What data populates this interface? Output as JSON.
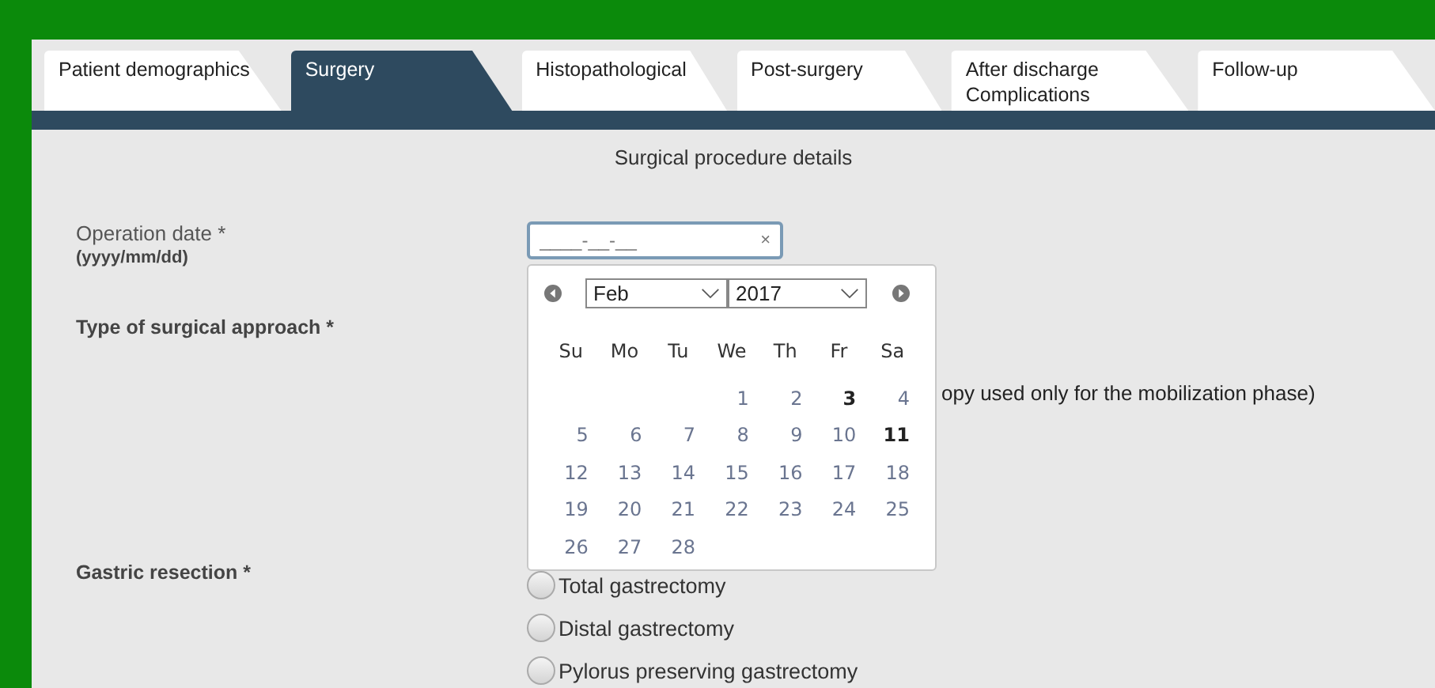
{
  "tabs": [
    {
      "label": "Patient demographics",
      "selected": false
    },
    {
      "label": "Surgery",
      "selected": true
    },
    {
      "label": "Histopathological",
      "selected": false
    },
    {
      "label": "Post-surgery",
      "selected": false
    },
    {
      "label": "After discharge\nComplications",
      "selected": false
    },
    {
      "label": "Follow-up",
      "selected": false
    }
  ],
  "section_title": "Surgical procedure details",
  "operation_date": {
    "label": "Operation date *",
    "hint": "(yyyy/mm/dd)",
    "placeholder": "____-__-__",
    "clear": "×"
  },
  "calendar": {
    "month": "Feb",
    "year": "2017",
    "weekdays": [
      "Su",
      "Mo",
      "Tu",
      "We",
      "Th",
      "Fr",
      "Sa"
    ],
    "weeks": [
      {
        "days": [
          {
            "label": "1",
            "bold": false
          },
          {
            "label": "2",
            "bold": false
          },
          {
            "label": "3",
            "bold": true
          },
          {
            "label": "4",
            "bold": false
          }
        ]
      },
      {
        "days": [
          {
            "label": "5",
            "bold": false
          },
          {
            "label": "6",
            "bold": false
          },
          {
            "label": "7",
            "bold": false
          },
          {
            "label": "8",
            "bold": false
          },
          {
            "label": "9",
            "bold": false
          },
          {
            "label": "10",
            "bold": false
          },
          {
            "label": "11",
            "bold": true
          }
        ]
      },
      {
        "days": [
          {
            "label": "12",
            "bold": false
          },
          {
            "label": "13",
            "bold": false
          },
          {
            "label": "14",
            "bold": false
          },
          {
            "label": "15",
            "bold": false
          },
          {
            "label": "16",
            "bold": false
          },
          {
            "label": "17",
            "bold": false
          },
          {
            "label": "18",
            "bold": false
          }
        ]
      },
      {
        "days": [
          {
            "label": "19",
            "bold": false
          },
          {
            "label": "20",
            "bold": false
          },
          {
            "label": "21",
            "bold": false
          },
          {
            "label": "22",
            "bold": false
          },
          {
            "label": "23",
            "bold": false
          },
          {
            "label": "24",
            "bold": false
          },
          {
            "label": "25",
            "bold": false
          }
        ]
      },
      {
        "days": [
          {
            "label": "26",
            "bold": false
          },
          {
            "label": "27",
            "bold": false
          },
          {
            "label": "28",
            "bold": false
          }
        ]
      }
    ]
  },
  "surgical_approach": {
    "label": "Type of surgical approach *",
    "visible_option_text": "opy used only for the mobilization phase)"
  },
  "gastric_resection": {
    "label": "Gastric resection *",
    "options": [
      {
        "label": "Total gastrectomy",
        "selected": false
      },
      {
        "label": "Distal gastrectomy",
        "selected": false
      },
      {
        "label": "Pylorus preserving gastrectomy",
        "selected": false
      }
    ]
  }
}
